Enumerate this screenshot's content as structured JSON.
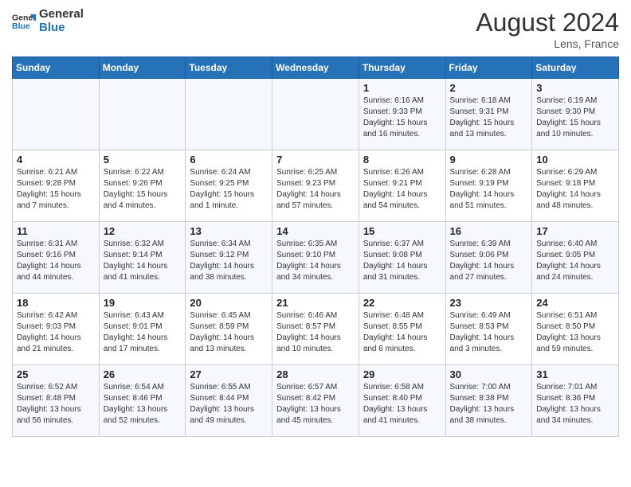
{
  "header": {
    "logo_line1": "General",
    "logo_line2": "Blue",
    "month_year": "August 2024",
    "location": "Lens, France"
  },
  "weekdays": [
    "Sunday",
    "Monday",
    "Tuesday",
    "Wednesday",
    "Thursday",
    "Friday",
    "Saturday"
  ],
  "weeks": [
    [
      {
        "day": "",
        "info": ""
      },
      {
        "day": "",
        "info": ""
      },
      {
        "day": "",
        "info": ""
      },
      {
        "day": "",
        "info": ""
      },
      {
        "day": "1",
        "info": "Sunrise: 6:16 AM\nSunset: 9:33 PM\nDaylight: 15 hours and 16 minutes."
      },
      {
        "day": "2",
        "info": "Sunrise: 6:18 AM\nSunset: 9:31 PM\nDaylight: 15 hours and 13 minutes."
      },
      {
        "day": "3",
        "info": "Sunrise: 6:19 AM\nSunset: 9:30 PM\nDaylight: 15 hours and 10 minutes."
      }
    ],
    [
      {
        "day": "4",
        "info": "Sunrise: 6:21 AM\nSunset: 9:28 PM\nDaylight: 15 hours and 7 minutes."
      },
      {
        "day": "5",
        "info": "Sunrise: 6:22 AM\nSunset: 9:26 PM\nDaylight: 15 hours and 4 minutes."
      },
      {
        "day": "6",
        "info": "Sunrise: 6:24 AM\nSunset: 9:25 PM\nDaylight: 15 hours and 1 minute."
      },
      {
        "day": "7",
        "info": "Sunrise: 6:25 AM\nSunset: 9:23 PM\nDaylight: 14 hours and 57 minutes."
      },
      {
        "day": "8",
        "info": "Sunrise: 6:26 AM\nSunset: 9:21 PM\nDaylight: 14 hours and 54 minutes."
      },
      {
        "day": "9",
        "info": "Sunrise: 6:28 AM\nSunset: 9:19 PM\nDaylight: 14 hours and 51 minutes."
      },
      {
        "day": "10",
        "info": "Sunrise: 6:29 AM\nSunset: 9:18 PM\nDaylight: 14 hours and 48 minutes."
      }
    ],
    [
      {
        "day": "11",
        "info": "Sunrise: 6:31 AM\nSunset: 9:16 PM\nDaylight: 14 hours and 44 minutes."
      },
      {
        "day": "12",
        "info": "Sunrise: 6:32 AM\nSunset: 9:14 PM\nDaylight: 14 hours and 41 minutes."
      },
      {
        "day": "13",
        "info": "Sunrise: 6:34 AM\nSunset: 9:12 PM\nDaylight: 14 hours and 38 minutes."
      },
      {
        "day": "14",
        "info": "Sunrise: 6:35 AM\nSunset: 9:10 PM\nDaylight: 14 hours and 34 minutes."
      },
      {
        "day": "15",
        "info": "Sunrise: 6:37 AM\nSunset: 9:08 PM\nDaylight: 14 hours and 31 minutes."
      },
      {
        "day": "16",
        "info": "Sunrise: 6:39 AM\nSunset: 9:06 PM\nDaylight: 14 hours and 27 minutes."
      },
      {
        "day": "17",
        "info": "Sunrise: 6:40 AM\nSunset: 9:05 PM\nDaylight: 14 hours and 24 minutes."
      }
    ],
    [
      {
        "day": "18",
        "info": "Sunrise: 6:42 AM\nSunset: 9:03 PM\nDaylight: 14 hours and 21 minutes."
      },
      {
        "day": "19",
        "info": "Sunrise: 6:43 AM\nSunset: 9:01 PM\nDaylight: 14 hours and 17 minutes."
      },
      {
        "day": "20",
        "info": "Sunrise: 6:45 AM\nSunset: 8:59 PM\nDaylight: 14 hours and 13 minutes."
      },
      {
        "day": "21",
        "info": "Sunrise: 6:46 AM\nSunset: 8:57 PM\nDaylight: 14 hours and 10 minutes."
      },
      {
        "day": "22",
        "info": "Sunrise: 6:48 AM\nSunset: 8:55 PM\nDaylight: 14 hours and 6 minutes."
      },
      {
        "day": "23",
        "info": "Sunrise: 6:49 AM\nSunset: 8:53 PM\nDaylight: 14 hours and 3 minutes."
      },
      {
        "day": "24",
        "info": "Sunrise: 6:51 AM\nSunset: 8:50 PM\nDaylight: 13 hours and 59 minutes."
      }
    ],
    [
      {
        "day": "25",
        "info": "Sunrise: 6:52 AM\nSunset: 8:48 PM\nDaylight: 13 hours and 56 minutes."
      },
      {
        "day": "26",
        "info": "Sunrise: 6:54 AM\nSunset: 8:46 PM\nDaylight: 13 hours and 52 minutes."
      },
      {
        "day": "27",
        "info": "Sunrise: 6:55 AM\nSunset: 8:44 PM\nDaylight: 13 hours and 49 minutes."
      },
      {
        "day": "28",
        "info": "Sunrise: 6:57 AM\nSunset: 8:42 PM\nDaylight: 13 hours and 45 minutes."
      },
      {
        "day": "29",
        "info": "Sunrise: 6:58 AM\nSunset: 8:40 PM\nDaylight: 13 hours and 41 minutes."
      },
      {
        "day": "30",
        "info": "Sunrise: 7:00 AM\nSunset: 8:38 PM\nDaylight: 13 hours and 38 minutes."
      },
      {
        "day": "31",
        "info": "Sunrise: 7:01 AM\nSunset: 8:36 PM\nDaylight: 13 hours and 34 minutes."
      }
    ]
  ]
}
